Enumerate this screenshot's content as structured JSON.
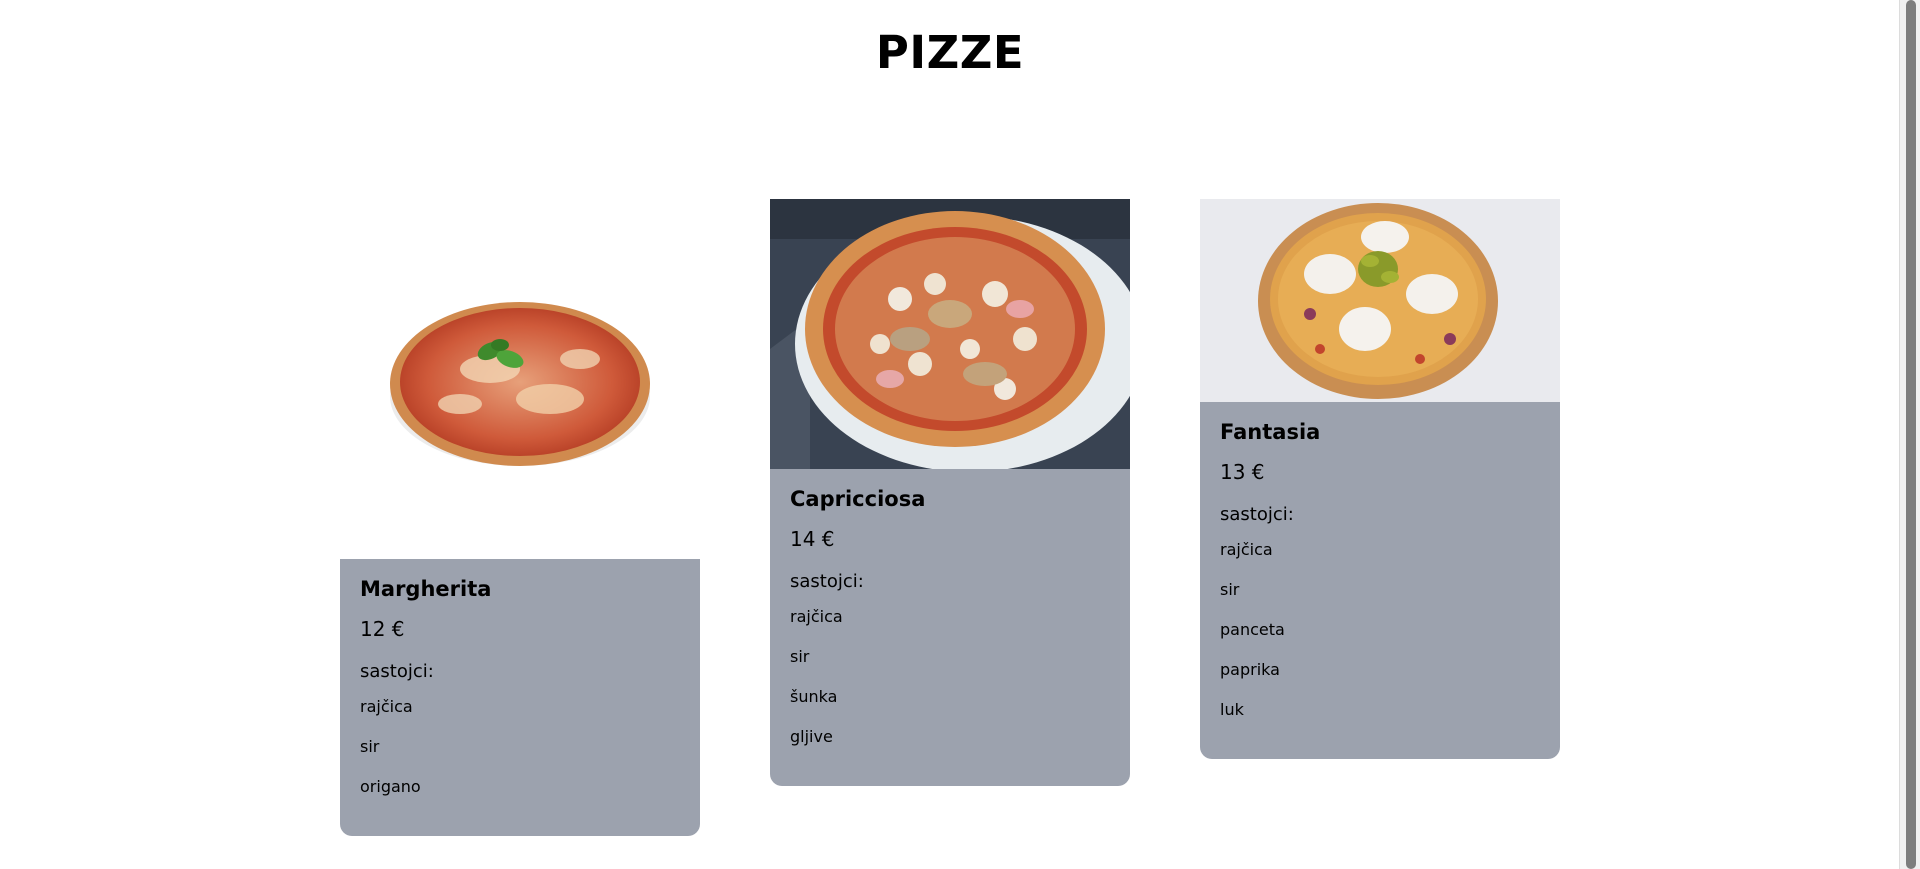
{
  "page": {
    "title": "PIZZE"
  },
  "pizzas": [
    {
      "name": "Margherita",
      "price": "12 €",
      "ingredients_label": "sastojci:",
      "ingredients": [
        "rajčica",
        "sir",
        "origano"
      ],
      "image_icon": "pizza-margherita-image"
    },
    {
      "name": "Capricciosa",
      "price": "14 €",
      "ingredients_label": "sastojci:",
      "ingredients": [
        "rajčica",
        "sir",
        "šunka",
        "gljive"
      ],
      "image_icon": "pizza-capricciosa-image"
    },
    {
      "name": "Fantasia",
      "price": "13 €",
      "ingredients_label": "sastojci:",
      "ingredients": [
        "rajčica",
        "sir",
        "panceta",
        "paprika",
        "luk"
      ],
      "image_icon": "pizza-fantasia-image"
    }
  ],
  "colors": {
    "card_info_bg": "#9ca2ae",
    "page_bg": "#ffffff"
  }
}
